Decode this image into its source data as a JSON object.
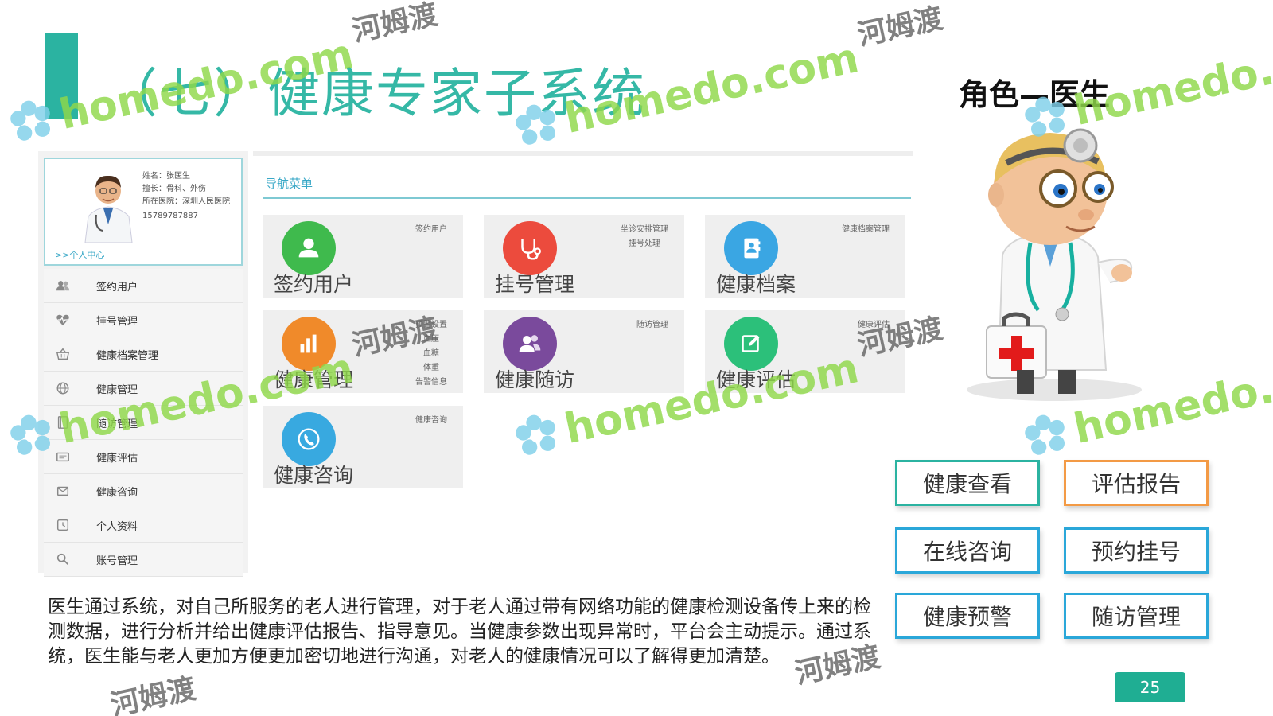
{
  "slide": {
    "title": "（七）健康专家子系统",
    "role_title": "角色—医生",
    "page_number": "25",
    "description": "医生通过系统，对自己所服务的老人进行管理，对于老人通过带有网络功能的健康检测设备传上来的检测数据，进行分析并给出健康评估报告、指导意见。当健康参数出现异常时，平台会主动提示。通过系统，医生能与老人更加方便更加密切地进行沟通，对老人的健康情况可以了解得更加清楚。"
  },
  "profile": {
    "name": "姓名：张医生",
    "specialty": "擅长：骨科、外伤",
    "hospital": "所在医院：深圳人民医院",
    "phone": "15789787887",
    "center_link": ">>个人中心"
  },
  "sidebar": {
    "items": [
      {
        "label": "签约用户",
        "icon": "users-icon"
      },
      {
        "label": "挂号管理",
        "icon": "heart-icon"
      },
      {
        "label": "健康档案管理",
        "icon": "basket-icon"
      },
      {
        "label": "健康管理",
        "icon": "globe-icon"
      },
      {
        "label": "随访管理",
        "icon": "book-icon"
      },
      {
        "label": "健康评估",
        "icon": "clipboard-icon"
      },
      {
        "label": "健康咨询",
        "icon": "mail-icon"
      },
      {
        "label": "个人资料",
        "icon": "clock-icon"
      },
      {
        "label": "账号管理",
        "icon": "search-icon"
      }
    ]
  },
  "nav": {
    "header": "导航菜单",
    "tiles": [
      {
        "label": "签约用户",
        "subs": [
          "签约用户"
        ],
        "color": "#3fba4d",
        "icon": "user-icon"
      },
      {
        "label": "挂号管理",
        "subs": [
          "坐诊安排管理",
          "挂号处理"
        ],
        "color": "#ec4b3d",
        "icon": "stethoscope-icon"
      },
      {
        "label": "健康档案",
        "subs": [
          "健康档案管理"
        ],
        "color": "#3aa6e3",
        "icon": "record-book-icon"
      },
      {
        "label": "健康管理",
        "subs": [
          "预警设置",
          "血压",
          "血糖",
          "体重",
          "告警信息"
        ],
        "color": "#f08a2a",
        "icon": "chart-icon"
      },
      {
        "label": "健康随访",
        "subs": [
          "随访管理"
        ],
        "color": "#7a4a9c",
        "icon": "people-icon"
      },
      {
        "label": "健康评估",
        "subs": [
          "健康评估"
        ],
        "color": "#2cc07a",
        "icon": "edit-icon"
      },
      {
        "label": "健康咨询",
        "subs": [
          "健康咨询"
        ],
        "color": "#38a9e0",
        "icon": "phone-icon"
      }
    ]
  },
  "function_buttons": [
    {
      "label": "健康查看",
      "color": "#2bb3a1"
    },
    {
      "label": "评估报告",
      "color": "#f39a45"
    },
    {
      "label": "在线咨询",
      "color": "#2aa7d9"
    },
    {
      "label": "预约挂号",
      "color": "#2aa7d9"
    },
    {
      "label": "健康预警",
      "color": "#2aa7d9"
    },
    {
      "label": "随访管理",
      "color": "#2aa7d9"
    }
  ],
  "watermark": {
    "text": "homedo.com",
    "cn": "河姆渡"
  }
}
